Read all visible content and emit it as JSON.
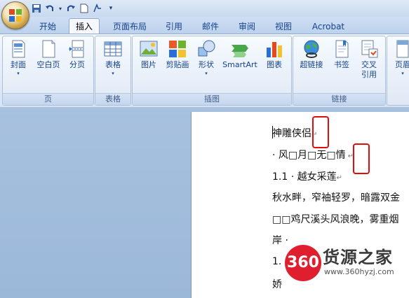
{
  "quick_access": {
    "items": [
      "save-icon",
      "undo-icon",
      "undo-dropdown-icon",
      "redo-icon",
      "new-doc-icon",
      "format-icon",
      "customize-icon"
    ]
  },
  "tabs": [
    "开始",
    "插入",
    "页面布局",
    "引用",
    "邮件",
    "审阅",
    "视图",
    "Acrobat"
  ],
  "active_tab": "插入",
  "ribbon": {
    "groups": {
      "pages": {
        "label": "页",
        "buttons": [
          "封面",
          "空白页",
          "分页"
        ]
      },
      "tables": {
        "label": "表格",
        "buttons": [
          "表格"
        ]
      },
      "illustrations": {
        "label": "插图",
        "buttons": [
          "图片",
          "剪贴画",
          "形状",
          "SmartArt",
          "图表"
        ]
      },
      "links": {
        "label": "链接",
        "buttons": [
          "超链接",
          "书签",
          "交叉",
          "引用"
        ]
      },
      "header": {
        "label": "",
        "buttons": [
          "页眉"
        ]
      }
    }
  },
  "document": {
    "lines": [
      "神雕侠侣",
      "· 风□月□无□情",
      "1.1 · 越女采莲",
      "秋水畔，窄袖轻罗，暗露双金",
      "□□鸡尺溪头风浪晚，雾重烟",
      "岸 ·",
      "1.",
      "娇"
    ]
  },
  "watermark": {
    "badge": "360",
    "title": "货源之家",
    "url": "www.360hyzj.com"
  },
  "colors": {
    "accent": "#15428b",
    "highlight": "#e00d0d",
    "ribbon": "#dfe8f5"
  }
}
